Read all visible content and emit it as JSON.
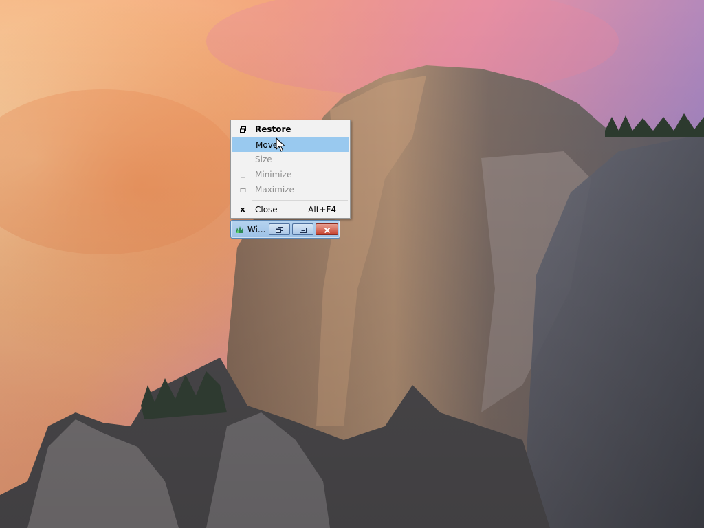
{
  "desktop": {
    "wallpaper": "yosemite-el-capitan-sunset-wallpaper"
  },
  "system_menu": {
    "items": [
      {
        "label": "Restore",
        "icon": "restore-icon",
        "enabled": true,
        "bold": true,
        "shortcut": ""
      },
      {
        "label": "Move",
        "icon": "",
        "enabled": true,
        "highlighted": true,
        "shortcut": ""
      },
      {
        "label": "Size",
        "icon": "",
        "enabled": false,
        "shortcut": ""
      },
      {
        "label": "Minimize",
        "icon": "minimize-icon",
        "enabled": false,
        "shortcut": ""
      },
      {
        "label": "Maximize",
        "icon": "maximize-icon",
        "enabled": false,
        "shortcut": ""
      },
      {
        "label": "Close",
        "icon": "close-x-icon",
        "enabled": true,
        "shortcut": "Alt+F4"
      }
    ],
    "colors": {
      "highlight": "#99c9ef",
      "background": "#f2f2f2",
      "disabled_text": "#8d8d8d"
    }
  },
  "minimized_window": {
    "title": "Wi...",
    "app_icon": "app-icon",
    "buttons": [
      "restore-icon",
      "maximize-icon",
      "close-icon"
    ],
    "colors": {
      "caption": "#9cc1e6",
      "close_button": "#c7422f"
    }
  },
  "cursor": {
    "type": "arrow-cursor"
  }
}
